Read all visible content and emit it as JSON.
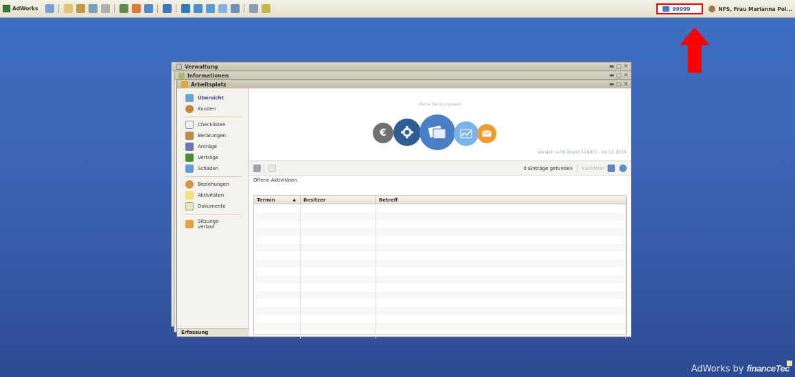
{
  "topbar": {
    "app_name": "AdWorks",
    "user_id": "99999",
    "user_name": "NFS, Frau Marianna Pol..."
  },
  "windows": {
    "back1_title": "Verwaltung",
    "back2_title": "Informationen",
    "main_title": "Arbeitsplatz"
  },
  "sidebar": {
    "items": [
      {
        "label": "Übersicht"
      },
      {
        "label": "Kunden"
      },
      {
        "label": "Checklisten"
      },
      {
        "label": "Beratungen"
      },
      {
        "label": "Anträge"
      },
      {
        "label": "Verträge"
      },
      {
        "label": "Schäden"
      },
      {
        "label": "Beziehungen"
      },
      {
        "label": "Aktivitäten"
      },
      {
        "label": "Dokumente"
      },
      {
        "label": "Sitzungs-verlauf"
      }
    ],
    "footer": "Erfassung"
  },
  "banner": {
    "title": "Meine Beratungswelt",
    "version": "Version 4.09 (Build 51930) - 16.12.2019"
  },
  "list": {
    "found_text": "0 Einträge gefunden",
    "search_placeholder": "Suchfilter",
    "caption": "Offene Aktivitäten.",
    "columns": [
      "Termin",
      "Besitzer",
      "Betreff"
    ],
    "sort_indicator": "▲"
  },
  "brand": {
    "prefix": "AdWorks by ",
    "company": "financeTec"
  },
  "colors": {
    "highlight": "#e00000",
    "desktop": "#3d66b7"
  }
}
